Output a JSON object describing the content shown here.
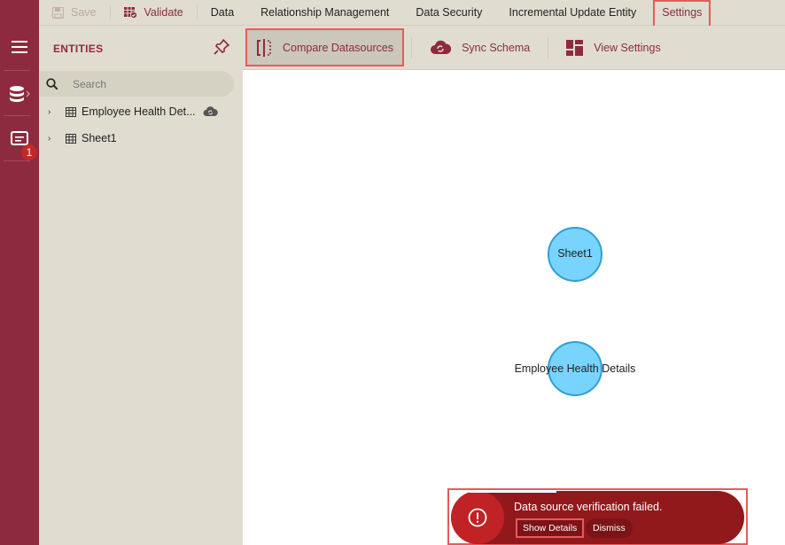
{
  "rail": {
    "menu_icon": "hamburger-menu-icon",
    "datasource_icon": "database-icon",
    "messages_icon": "message-icon",
    "messages_badge": "1"
  },
  "topbar": {
    "items": [
      {
        "label": "Save",
        "icon": "save-icon",
        "disabled": true
      },
      {
        "label": "Validate",
        "icon": "validate-table-icon"
      },
      {
        "label": "Data"
      },
      {
        "label": "Relationship Management"
      },
      {
        "label": "Data Security"
      },
      {
        "label": "Incremental Update Entity"
      },
      {
        "label": "Settings",
        "active": true
      }
    ]
  },
  "sidebar": {
    "title": "ENTITIES",
    "search_placeholder": "Search",
    "search_value": "",
    "entities": [
      {
        "label": "Employee Health Det...",
        "status_icon": "cloud-sync-icon"
      },
      {
        "label": "Sheet1"
      }
    ]
  },
  "ribbon": {
    "buttons": [
      {
        "label": "Compare Datasources",
        "icon": "compare-icon",
        "pressed": true
      },
      {
        "label": "Sync Schema",
        "icon": "cloud-sync-icon"
      },
      {
        "label": "View Settings",
        "icon": "layout-icon"
      }
    ]
  },
  "canvas": {
    "nodes": [
      {
        "label": "Sheet1"
      },
      {
        "label": "Employee Health Details"
      }
    ]
  },
  "toast": {
    "icon": "error-circle-icon",
    "message": "Data source verification failed.",
    "show_details_label": "Show Details",
    "dismiss_label": "Dismiss",
    "progress": 0.36
  },
  "colors": {
    "brand": "#8e2a3f",
    "panel_bg": "#e0ddd0",
    "node_fill": "#79d4fd",
    "node_stroke": "#2e9fd5",
    "toast_bg": "#92191b",
    "highlight": "#e85a5a"
  }
}
